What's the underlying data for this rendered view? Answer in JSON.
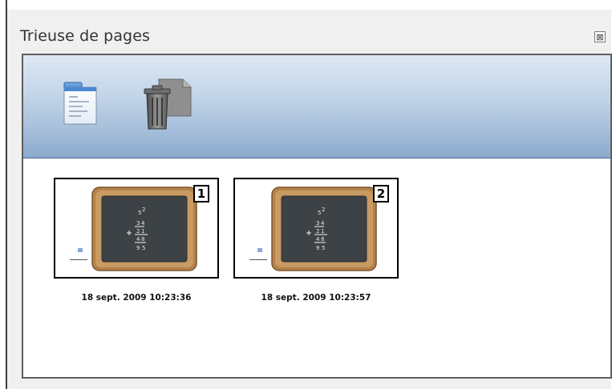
{
  "panel": {
    "title": "Trieuse de pages",
    "close_icon": "close-x-icon"
  },
  "toolbar": {
    "buttons": [
      {
        "name": "new-page",
        "icon": "new-page-icon"
      },
      {
        "name": "delete-page",
        "icon": "trash-icon"
      }
    ]
  },
  "pages": [
    {
      "number": "1",
      "timestamp": "18 sept. 2009 10:23:36"
    },
    {
      "number": "2",
      "timestamp": "18 sept. 2009 10:23:57"
    }
  ],
  "colors": {
    "toolbar_top": "#dde8f4",
    "toolbar_bottom": "#8aa9cc",
    "chalkboard_frame": "#b5824a",
    "chalkboard": "#3c4246"
  }
}
